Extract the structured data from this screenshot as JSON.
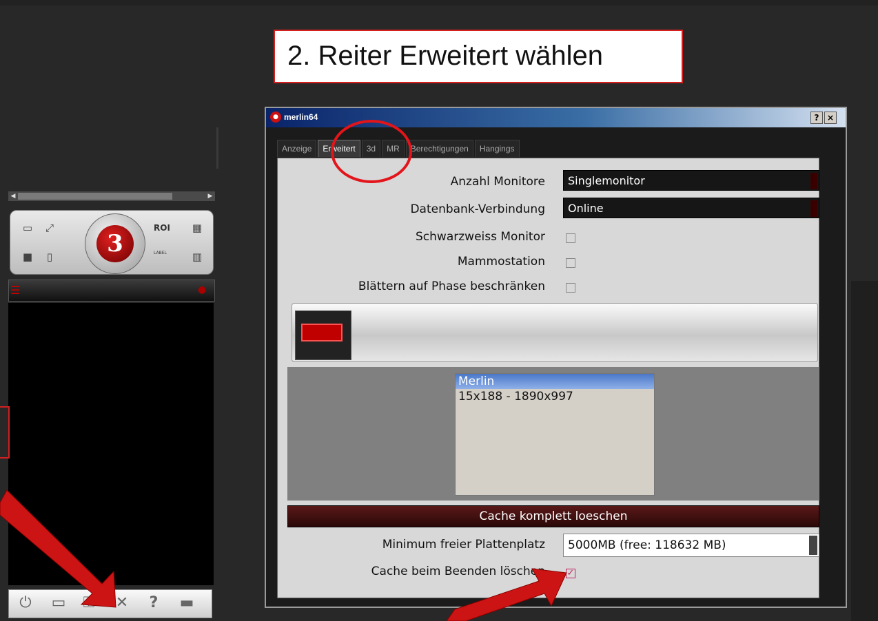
{
  "callout": {
    "text": "2. Reiter Erweitert wählen"
  },
  "dialog": {
    "title": "merlin64",
    "help_button": "?",
    "close_button": "×",
    "tabs": [
      {
        "label": "Anzeige"
      },
      {
        "label": "Erweitert",
        "active": true
      },
      {
        "label": "3d"
      },
      {
        "label": "MR"
      },
      {
        "label": "Berechtigungen"
      },
      {
        "label": "Hangings"
      }
    ],
    "settings": {
      "monitors_label": "Anzahl Monitore",
      "monitors_value": "Singlemonitor",
      "db_label": "Datenbank-Verbindung",
      "db_value": "Online",
      "bw_monitor_label": "Schwarzweiss Monitor",
      "bw_monitor_checked": false,
      "mammo_label": "Mammostation",
      "mammo_checked": false,
      "phase_label": "Blättern auf Phase beschränken",
      "phase_checked": false
    },
    "monitor_list": [
      "Merlin",
      "15x188 - 1890x997"
    ],
    "cache_button": "Cache komplett loeschen",
    "disk_label": "Minimum freier Plattenplatz",
    "disk_value": "5000MB (free: 118632 MB)",
    "clear_on_exit_label": "Cache beim Beenden löschen",
    "clear_on_exit_checked": true
  },
  "toolbar": {
    "roi": "ROI",
    "label": "LABEL"
  },
  "logo_glyph": "3",
  "colors": {
    "accent_red": "#e3141a",
    "title_blue": "#0a246a",
    "checkbox_pink": "#c0205a"
  },
  "bottom_icons": [
    "power-icon",
    "window-icon",
    "key-icon",
    "tools-icon",
    "help-icon",
    "keyboard-icon"
  ]
}
